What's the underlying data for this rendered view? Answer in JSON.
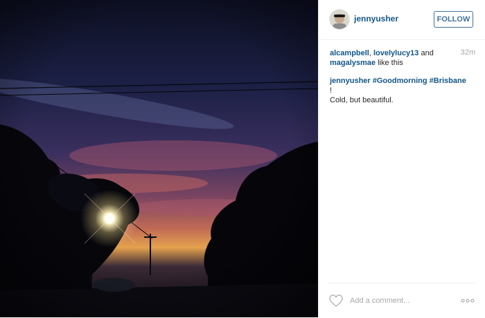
{
  "post": {
    "username": "jennyusher",
    "follow_label": "FOLLOW",
    "time_ago": "32m",
    "likes": {
      "users": [
        "alcampbell",
        "lovelylucy13",
        "magalysmae"
      ],
      "sep1": ", ",
      "sep2": " and ",
      "suffix": " like this"
    },
    "caption": {
      "author": "jennyusher",
      "hashtags": [
        "#Goodmorning",
        "#Brisbane"
      ],
      "trail": " !",
      "line2": "Cold, but beautiful."
    },
    "comment": {
      "placeholder": "Add a comment..."
    },
    "photo_icon": "sunrise-street-photo"
  },
  "colors": {
    "link": "#125688",
    "follow": "#3f729b",
    "muted": "#a5a7aa"
  }
}
